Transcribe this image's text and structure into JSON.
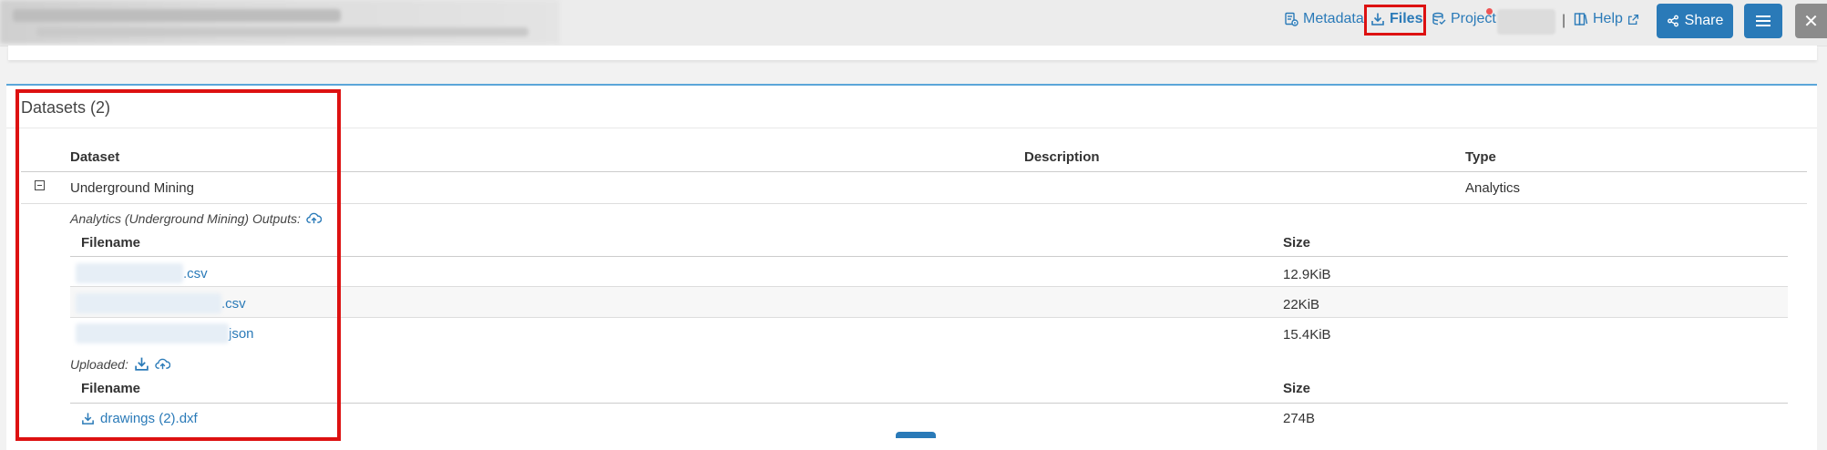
{
  "header": {
    "nav": {
      "metadata": "Metadata",
      "files": "Files",
      "project": "Project",
      "separator": "|",
      "help": "Help"
    },
    "share_label": "Share",
    "close_symbol": "✕"
  },
  "datasets": {
    "title": "Datasets (2)",
    "columns": {
      "dataset": "Dataset",
      "description": "Description",
      "type": "Type"
    },
    "rows": [
      {
        "name": "Underground Mining",
        "type": "Analytics",
        "outputs_label": "Analytics (Underground Mining) Outputs:",
        "outputs_columns": {
          "filename": "Filename",
          "size": "Size"
        },
        "outputs": [
          {
            "name_suffix": ".csv",
            "size": "12.9KiB"
          },
          {
            "name_suffix": ".csv",
            "size": "22KiB"
          },
          {
            "name_suffix": "json",
            "size": "15.4KiB"
          }
        ],
        "uploaded_label": "Uploaded:",
        "uploaded_columns": {
          "filename": "Filename",
          "size": "Size"
        },
        "uploaded": [
          {
            "name": "drawings (2).dxf",
            "size": "274B"
          }
        ]
      }
    ]
  },
  "colors": {
    "accent": "#2a7ab8",
    "highlight": "#dd1111",
    "panel_border": "#5ba6d9"
  },
  "icons": [
    "metadata-icon",
    "download-icon",
    "project-icon",
    "help-book-icon",
    "external-link-icon",
    "share-icon",
    "menu-icon",
    "close-icon",
    "collapse-icon",
    "upload-cloud-icon"
  ]
}
